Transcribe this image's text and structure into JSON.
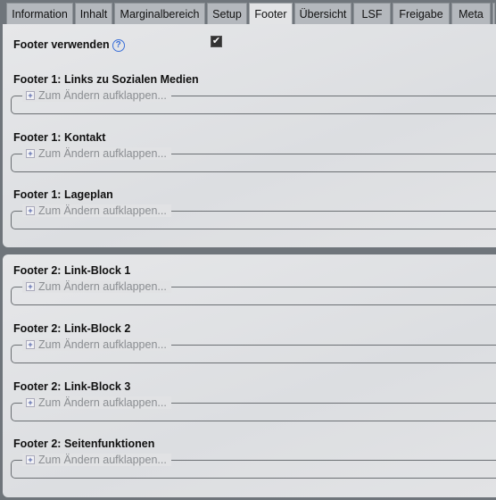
{
  "tabs": [
    {
      "label": "Information"
    },
    {
      "label": "Inhalt"
    },
    {
      "label": "Marginalbereich"
    },
    {
      "label": "Setup"
    },
    {
      "label": "Footer",
      "active": true
    },
    {
      "label": "Übersicht"
    },
    {
      "label": "LSF"
    },
    {
      "label": "Freigabe"
    },
    {
      "label": "Meta"
    }
  ],
  "footer_toggle": {
    "label": "Footer verwenden",
    "checked": true,
    "help_icon": "question-circle-icon"
  },
  "collapse_label": "Zum Ändern aufklappen...",
  "panel1": {
    "sections": [
      {
        "title": "Footer 1: Links zu Sozialen Medien"
      },
      {
        "title": "Footer 1: Kontakt"
      },
      {
        "title": "Footer 1: Lageplan"
      }
    ]
  },
  "panel2": {
    "sections": [
      {
        "title": "Footer 2: Link-Block 1"
      },
      {
        "title": "Footer 2: Link-Block 2"
      },
      {
        "title": "Footer 2: Link-Block 3"
      },
      {
        "title": "Footer 2: Seitenfunktionen"
      }
    ]
  }
}
